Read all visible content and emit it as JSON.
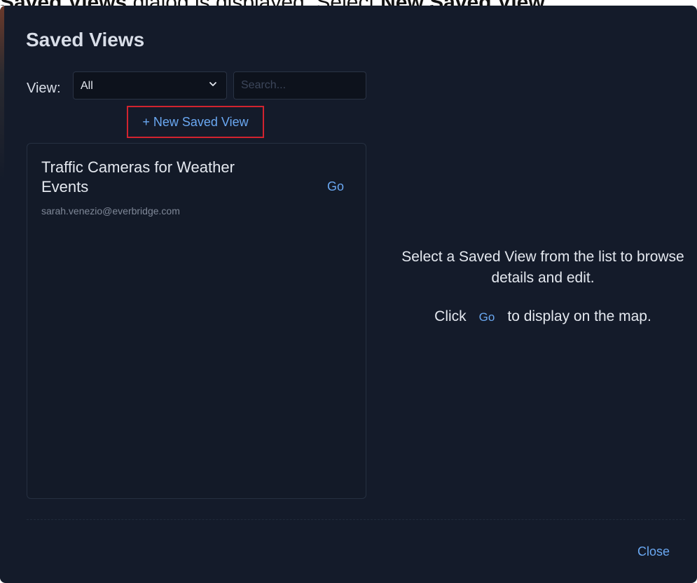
{
  "caption": {
    "prefix": "Saved Views",
    "middle": " dialog is displayed. Select ",
    "emphasis": "New Saved View."
  },
  "dialog": {
    "title": "Saved Views",
    "filter": {
      "label": "View:",
      "selected": "All",
      "chevron_icon": "chevron-down-icon"
    },
    "search": {
      "value": "",
      "placeholder": "Search..."
    },
    "new_saved_view_label": "+ New Saved View",
    "list": {
      "items": [
        {
          "title": "Traffic Cameras for Weather Events",
          "owner": "sarah.venezio@everbridge.com",
          "go_label": "Go"
        }
      ]
    },
    "help": {
      "line1": "Select a Saved View from the list to browse details and edit.",
      "line2_prefix": "Click",
      "line2_go": "Go",
      "line2_suffix": "to display on the map."
    },
    "close_label": "Close"
  },
  "colors": {
    "dialog_bg": "#141b2a",
    "accent_link": "#6aa8f2",
    "highlight_border": "#d2232f",
    "text_primary": "#e4e8ef",
    "text_muted": "#7f8898"
  }
}
